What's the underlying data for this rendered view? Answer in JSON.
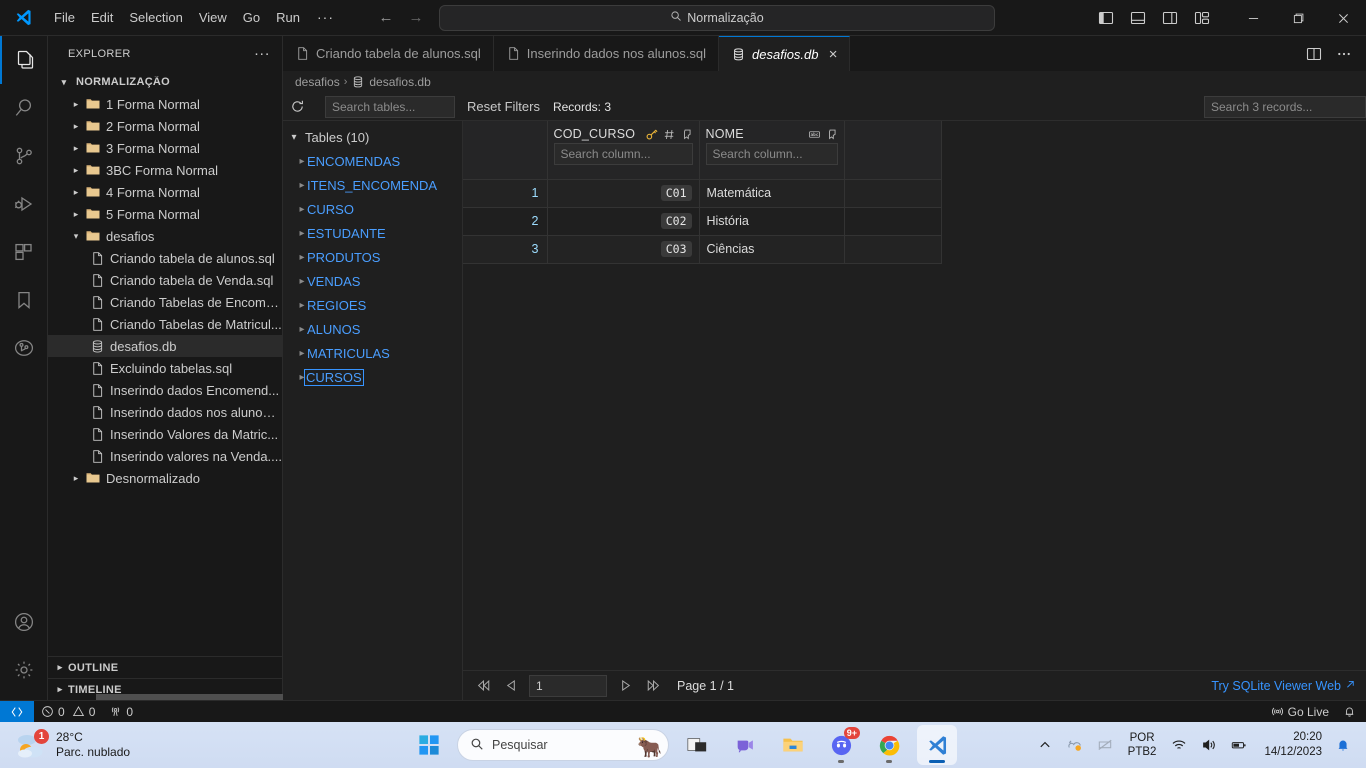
{
  "titlebar": {
    "menus": [
      "File",
      "Edit",
      "Selection",
      "View",
      "Go",
      "Run"
    ],
    "more": "···",
    "command_center": "Normalização",
    "search_icon": "search-icon",
    "back_arrow": "←",
    "forward_arrow": "→"
  },
  "activitybar": {
    "items": [
      {
        "name": "explorer",
        "icon": "files-icon",
        "active": true
      },
      {
        "name": "search",
        "icon": "search-icon",
        "active": false
      },
      {
        "name": "source-control",
        "icon": "source-control-icon",
        "active": false
      },
      {
        "name": "run-and-debug",
        "icon": "debug-icon",
        "active": false
      },
      {
        "name": "extensions",
        "icon": "extensions-icon",
        "active": false
      },
      {
        "name": "bookmarks",
        "icon": "bookmark-icon",
        "active": false
      },
      {
        "name": "git-graph",
        "icon": "git-graph-icon",
        "active": false
      }
    ],
    "bottom": [
      {
        "name": "accounts",
        "icon": "account-icon"
      },
      {
        "name": "settings",
        "icon": "gear-icon"
      }
    ]
  },
  "sidebar": {
    "title": "EXPLORER",
    "more": "···",
    "root": "NORMALIZAÇÃO",
    "tree": [
      {
        "label": "1 Forma Normal",
        "type": "folder",
        "depth": 1,
        "expanded": false
      },
      {
        "label": "2 Forma Normal",
        "type": "folder",
        "depth": 1,
        "expanded": false
      },
      {
        "label": "3 Forma Normal",
        "type": "folder",
        "depth": 1,
        "expanded": false
      },
      {
        "label": "3BC Forma Normal",
        "type": "folder",
        "depth": 1,
        "expanded": false
      },
      {
        "label": "4 Forma Normal",
        "type": "folder",
        "depth": 1,
        "expanded": false
      },
      {
        "label": "5 Forma Normal",
        "type": "folder",
        "depth": 1,
        "expanded": false
      },
      {
        "label": "desafios",
        "type": "folder",
        "depth": 1,
        "expanded": true
      },
      {
        "label": "Criando tabela de alunos.sql",
        "type": "file",
        "depth": 2
      },
      {
        "label": "Criando tabela de Venda.sql",
        "type": "file",
        "depth": 2
      },
      {
        "label": "Criando Tabelas de Encome...",
        "type": "file",
        "depth": 2
      },
      {
        "label": "Criando Tabelas de Matricul...",
        "type": "file",
        "depth": 2
      },
      {
        "label": "desafios.db",
        "type": "db",
        "depth": 2,
        "selected": true
      },
      {
        "label": "Excluindo tabelas.sql",
        "type": "file",
        "depth": 2
      },
      {
        "label": "Inserindo dados Encomend...",
        "type": "file",
        "depth": 2
      },
      {
        "label": "Inserindo dados nos alunos....",
        "type": "file",
        "depth": 2
      },
      {
        "label": "Inserindo Valores da Matric...",
        "type": "file",
        "depth": 2
      },
      {
        "label": "Inserindo valores na Venda....",
        "type": "file",
        "depth": 2
      },
      {
        "label": "Desnormalizado",
        "type": "folder",
        "depth": 1,
        "expanded": false
      }
    ],
    "sections": [
      {
        "label": "OUTLINE",
        "expanded": false
      },
      {
        "label": "TIMELINE",
        "expanded": false
      }
    ]
  },
  "tabs": [
    {
      "label": "Criando tabela de alunos.sql",
      "icon": "sql-file-icon",
      "active": false
    },
    {
      "label": "Inserindo dados nos alunos.sql",
      "icon": "sql-file-icon",
      "active": false
    },
    {
      "label": "desafios.db",
      "icon": "database-icon",
      "active": true,
      "close": "×"
    }
  ],
  "breadcrumb": {
    "folder": "desafios",
    "separator": "›",
    "file": "desafios.db",
    "icon": "database-icon"
  },
  "sqlite": {
    "toolbar": {
      "refresh_icon": "refresh-icon",
      "search_tables_placeholder": "Search tables...",
      "search_tables_value": "",
      "reset_filters": "Reset Filters",
      "records_label": "Records: 3",
      "search_records_placeholder": "Search 3 records...",
      "search_records_value": ""
    },
    "tables_group": "Tables (10)",
    "tables": [
      "ENCOMENDAS",
      "ITENS_ENCOMENDA",
      "CURSO",
      "ESTUDANTE",
      "PRODUTOS",
      "VENDAS",
      "REGIOES",
      "ALUNOS",
      "MATRICULAS",
      "CURSOS"
    ],
    "focused_table": "CURSOS",
    "grid": {
      "columns": [
        {
          "name": "COD_CURSO",
          "icons": [
            "key-icon",
            "number-type-icon",
            "pin-icon"
          ],
          "search_placeholder": "Search column..."
        },
        {
          "name": "NOME",
          "icons": [
            "text-type-icon",
            "pin-icon"
          ],
          "search_placeholder": "Search column..."
        }
      ],
      "rows": [
        {
          "idx": "1",
          "COD_CURSO": "C01",
          "NOME": "Matemática"
        },
        {
          "idx": "2",
          "COD_CURSO": "C02",
          "NOME": "História"
        },
        {
          "idx": "3",
          "COD_CURSO": "C03",
          "NOME": "Ciências"
        }
      ]
    },
    "pager": {
      "first_icon": "first-page-icon",
      "prev_icon": "prev-page-icon",
      "page_value": "1",
      "next_icon": "next-page-icon",
      "last_icon": "last-page-icon",
      "page_label": "Page 1 / 1",
      "try_web": "Try SQLite Viewer Web",
      "try_web_icon": "external-link-icon"
    }
  },
  "statusbar": {
    "remote_icon": "remote-indicator-icon",
    "errors": "0",
    "warnings": "0",
    "ports": "0",
    "go_live": "Go Live",
    "bell_icon": "bell-icon"
  },
  "taskbar": {
    "weather": {
      "temp": "28°C",
      "desc": "Parc. nublado",
      "badge": "1"
    },
    "search_placeholder": "Pesquisar",
    "apps": [
      {
        "name": "start",
        "icon": "windows-icon"
      },
      {
        "name": "task-view",
        "icon": "task-view-icon"
      },
      {
        "name": "teams",
        "icon": "teams-icon"
      },
      {
        "name": "file-explorer",
        "icon": "folder-icon"
      },
      {
        "name": "discord",
        "icon": "discord-icon",
        "badge": "9+"
      },
      {
        "name": "chrome",
        "icon": "chrome-icon"
      },
      {
        "name": "vscode",
        "icon": "vscode-icon",
        "active": true
      }
    ],
    "tray": {
      "chevron": "⌃",
      "language": "POR",
      "keyboard": "PTB2",
      "time": "20:20",
      "date": "14/12/2023"
    }
  },
  "colors": {
    "accent": "#0078d4",
    "link": "#3794ff",
    "table_name": "#4a9eff",
    "row_index": "#9cdcfe",
    "folder": "#dcb67a",
    "bg": "#1f1f1f",
    "bg_dark": "#181818",
    "badge_red": "#e3453c"
  }
}
